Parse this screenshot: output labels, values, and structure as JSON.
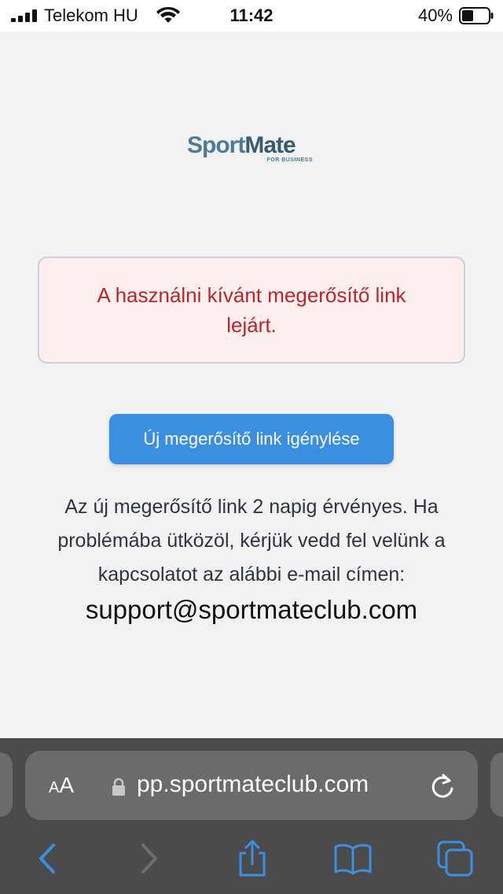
{
  "status_bar": {
    "carrier": "Telekom HU",
    "time": "11:42",
    "battery_percent": "40%"
  },
  "logo": {
    "part1": "Sport",
    "part2": "Mate",
    "sub": "FOR BUSINESS"
  },
  "error": {
    "message": "A használni kívánt megerősítő link lejárt."
  },
  "actions": {
    "renew_label": "Új megerősítő link igénylése"
  },
  "info": {
    "text": "Az új megerősítő link 2 napig érvényes. Ha problémába ütközöl, kérjük vedd fel velünk a kapcsolatot az alábbi e-mail címen:",
    "email": "support@sportmateclub.com"
  },
  "browser": {
    "aa_label_small": "A",
    "aa_label": "A",
    "url": "pp.sportmateclub.com"
  },
  "colors": {
    "accent": "#3b8fe0",
    "error_text": "#b7262a",
    "error_bg": "#fdeeee",
    "safari_icon": "#3b8fe0"
  }
}
